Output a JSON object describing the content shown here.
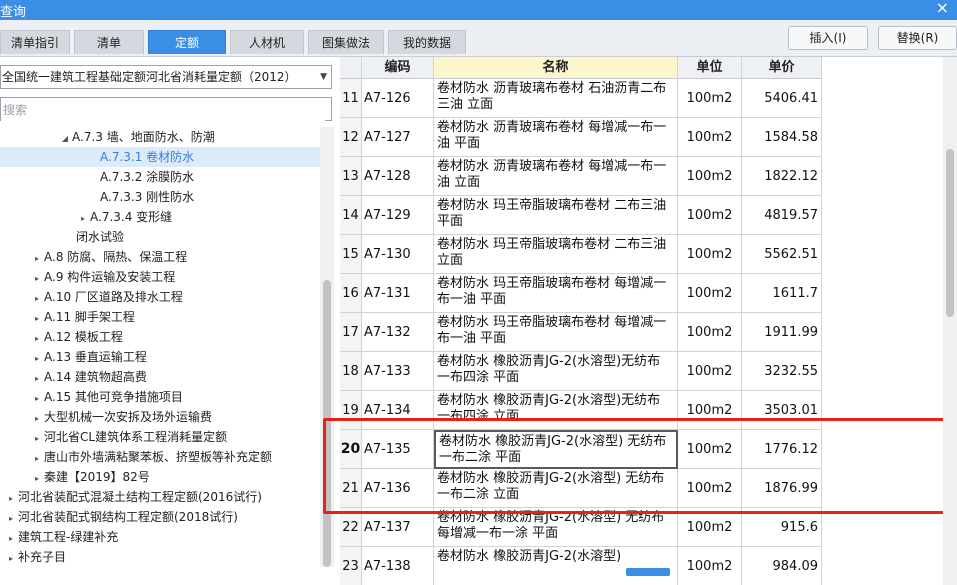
{
  "window": {
    "title": "查询",
    "close_glyph": "×"
  },
  "tabs": [
    {
      "label": "清单指引"
    },
    {
      "label": "清单"
    },
    {
      "label": "定额"
    },
    {
      "label": "人材机"
    },
    {
      "label": "图集做法"
    },
    {
      "label": "我的数据"
    }
  ],
  "active_tab": "定额",
  "buttons": {
    "insert": "插入(I)",
    "replace": "替换(R)"
  },
  "quota_selector": {
    "value": "全国统一建筑工程基础定额河北省消耗量定额（2012）"
  },
  "search": {
    "placeholder": "搜索",
    "value": ""
  },
  "tree": [
    {
      "label": "A.7.3 墙、地面防水、防潮",
      "expander": "◢"
    },
    {
      "label": "A.7.3.1 卷材防水",
      "expander": "",
      "selected": true
    },
    {
      "label": "A.7.3.2 涂膜防水",
      "expander": ""
    },
    {
      "label": "A.7.3.3 刚性防水",
      "expander": ""
    },
    {
      "label": "A.7.3.4 变形缝",
      "expander": "▸"
    },
    {
      "label": "闭水试验",
      "expander": ""
    },
    {
      "label": "A.8 防腐、隔热、保温工程",
      "expander": "▸"
    },
    {
      "label": "A.9 构件运输及安装工程",
      "expander": "▸"
    },
    {
      "label": "A.10 厂区道路及排水工程",
      "expander": "▸"
    },
    {
      "label": "A.11 脚手架工程",
      "expander": "▸"
    },
    {
      "label": "A.12 模板工程",
      "expander": "▸"
    },
    {
      "label": "A.13 垂直运输工程",
      "expander": "▸"
    },
    {
      "label": "A.14 建筑物超高费",
      "expander": "▸"
    },
    {
      "label": "A.15 其他可竞争措施项目",
      "expander": "▸"
    },
    {
      "label": "大型机械一次安拆及场外运输费",
      "expander": "▸"
    },
    {
      "label": "河北省CL建筑体系工程消耗量定额",
      "expander": "▸"
    },
    {
      "label": "唐山市外墙满粘聚苯板、挤塑板等补充定额",
      "expander": "▸"
    },
    {
      "label": "秦建【2019】82号",
      "expander": "▸"
    },
    {
      "label": "河北省装配式混凝土结构工程定额(2016试行)",
      "expander": "▸"
    },
    {
      "label": "河北省装配式钢结构工程定额(2018试行)",
      "expander": "▸"
    },
    {
      "label": "建筑工程-绿建补充",
      "expander": "▸"
    },
    {
      "label": "补充子目",
      "expander": "▸"
    }
  ],
  "table": {
    "columns": [
      "编码",
      "名称",
      "单位",
      "单价"
    ],
    "rows": [
      {
        "no": "11",
        "code": "A7-126",
        "name": "卷材防水 沥青玻璃布卷材 石油沥青二布三油 立面",
        "unit": "100m2",
        "price": "5406.41"
      },
      {
        "no": "12",
        "code": "A7-127",
        "name": "卷材防水 沥青玻璃布卷材 每增减一布一油 平面",
        "unit": "100m2",
        "price": "1584.58"
      },
      {
        "no": "13",
        "code": "A7-128",
        "name": "卷材防水 沥青玻璃布卷材 每增减一布一油 立面",
        "unit": "100m2",
        "price": "1822.12"
      },
      {
        "no": "14",
        "code": "A7-129",
        "name": "卷材防水 玛王帝脂玻璃布卷材 二布三油 平面",
        "unit": "100m2",
        "price": "4819.57"
      },
      {
        "no": "15",
        "code": "A7-130",
        "name": "卷材防水 玛王帝脂玻璃布卷材 二布三油 立面",
        "unit": "100m2",
        "price": "5562.51"
      },
      {
        "no": "16",
        "code": "A7-131",
        "name": "卷材防水 玛王帝脂玻璃布卷材 每增减一布一油 平面",
        "unit": "100m2",
        "price": "1611.7"
      },
      {
        "no": "17",
        "code": "A7-132",
        "name": "卷材防水 玛王帝脂玻璃布卷材 每增减一布一油 平面",
        "unit": "100m2",
        "price": "1911.99"
      },
      {
        "no": "18",
        "code": "A7-133",
        "name": "卷材防水 橡胶沥青JG-2(水溶型)无纺布 一布四涂 平面",
        "unit": "100m2",
        "price": "3232.55"
      },
      {
        "no": "19",
        "code": "A7-134",
        "name": "卷材防水 橡胶沥青JG-2(水溶型)无纺布 一布四涂 立面",
        "unit": "100m2",
        "price": "3503.01"
      },
      {
        "no": "20",
        "code": "A7-135",
        "name": "卷材防水 橡胶沥青JG-2(水溶型) 无纺布 一布二涂 平面",
        "unit": "100m2",
        "price": "1776.12",
        "current": true
      },
      {
        "no": "21",
        "code": "A7-136",
        "name": "卷材防水 橡胶沥青JG-2(水溶型) 无纺布 一布二涂 立面",
        "unit": "100m2",
        "price": "1876.99"
      },
      {
        "no": "22",
        "code": "A7-137",
        "name": "卷材防水 橡胶沥青JG-2(水溶型) 无纺布 每增减一布一涂 平面",
        "unit": "100m2",
        "price": "915.6"
      },
      {
        "no": "23",
        "code": "A7-138",
        "name": "卷材防水 橡胶沥青JG-2(水溶型)",
        "unit": "100m2",
        "price": "984.09"
      }
    ]
  }
}
